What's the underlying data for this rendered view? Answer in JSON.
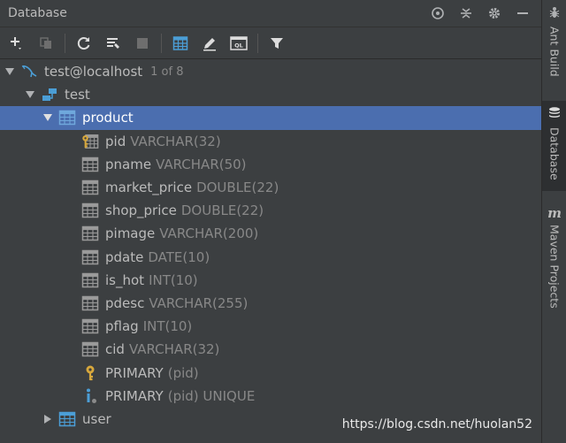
{
  "panel": {
    "title": "Database"
  },
  "tree": {
    "connection": {
      "name": "test@localhost",
      "count": "1 of 8"
    },
    "schema": {
      "name": "test"
    },
    "table_product": {
      "name": "product"
    },
    "columns": [
      {
        "name": "pid",
        "type": "VARCHAR(32)",
        "icon": "primary-key-column-icon"
      },
      {
        "name": "pname",
        "type": "VARCHAR(50)",
        "icon": "column-icon"
      },
      {
        "name": "market_price",
        "type": "DOUBLE(22)",
        "icon": "column-icon"
      },
      {
        "name": "shop_price",
        "type": "DOUBLE(22)",
        "icon": "column-icon"
      },
      {
        "name": "pimage",
        "type": "VARCHAR(200)",
        "icon": "column-icon"
      },
      {
        "name": "pdate",
        "type": "DATE(10)",
        "icon": "column-icon"
      },
      {
        "name": "is_hot",
        "type": "INT(10)",
        "icon": "column-icon"
      },
      {
        "name": "pdesc",
        "type": "VARCHAR(255)",
        "icon": "column-icon"
      },
      {
        "name": "pflag",
        "type": "INT(10)",
        "icon": "column-icon"
      },
      {
        "name": "cid",
        "type": "VARCHAR(32)",
        "icon": "column-icon"
      }
    ],
    "keys": [
      {
        "name": "PRIMARY",
        "type": "(pid)",
        "icon": "key-icon"
      },
      {
        "name": "PRIMARY",
        "type": "(pid) UNIQUE",
        "icon": "index-icon"
      }
    ],
    "table_user": {
      "name": "user"
    }
  },
  "side_tabs": {
    "ant": "Ant Build",
    "database": "Database",
    "maven": "Maven Projects"
  },
  "watermark": "https://blog.csdn.net/huolan52",
  "colors": {
    "selection": "#4b6eaf",
    "background": "#3c3f41",
    "key": "#d8a83c",
    "connection": "#4b9ed6"
  }
}
